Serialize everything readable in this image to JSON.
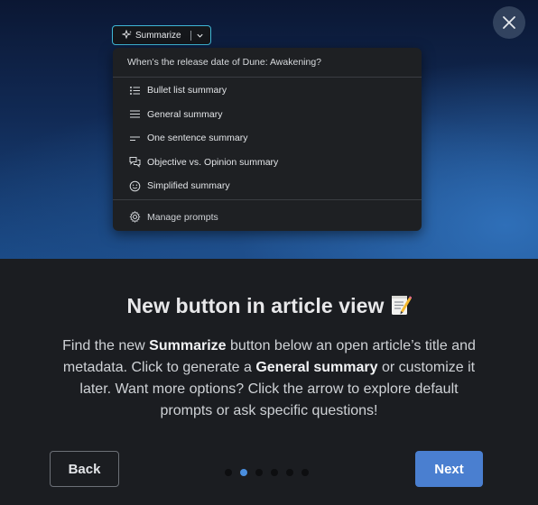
{
  "preview": {
    "summarize_button_label": "Summarize",
    "dropdown": {
      "question": "When’s the release date of Dune: Awakening?",
      "items": [
        {
          "label": "Bullet list summary",
          "icon": "bullet-list-icon"
        },
        {
          "label": "General summary",
          "icon": "lines-icon"
        },
        {
          "label": "One sentence summary",
          "icon": "short-lines-icon"
        },
        {
          "label": "Objective vs. Opinion summary",
          "icon": "speech-bubbles-icon"
        },
        {
          "label": "Simplified summary",
          "icon": "smiley-icon"
        }
      ],
      "manage_label": "Manage prompts"
    }
  },
  "dialog": {
    "title": "New button in article view",
    "title_icon": "memo-emoji-icon",
    "description": {
      "p1": "Find the new ",
      "b1": "Summarize",
      "p2": " button below an open article’s title and metadata. Click to generate a ",
      "b2": "General summary",
      "p3": " or customize it later. Want more options? Click the arrow to explore default prompts or ask specific questions!"
    },
    "back_label": "Back",
    "next_label": "Next",
    "pagination": {
      "total": 6,
      "current": 2
    }
  },
  "colors": {
    "accent": "#4a7fd0",
    "active_dot": "#4a8fe0",
    "button_outline": "#3fb7d6"
  }
}
